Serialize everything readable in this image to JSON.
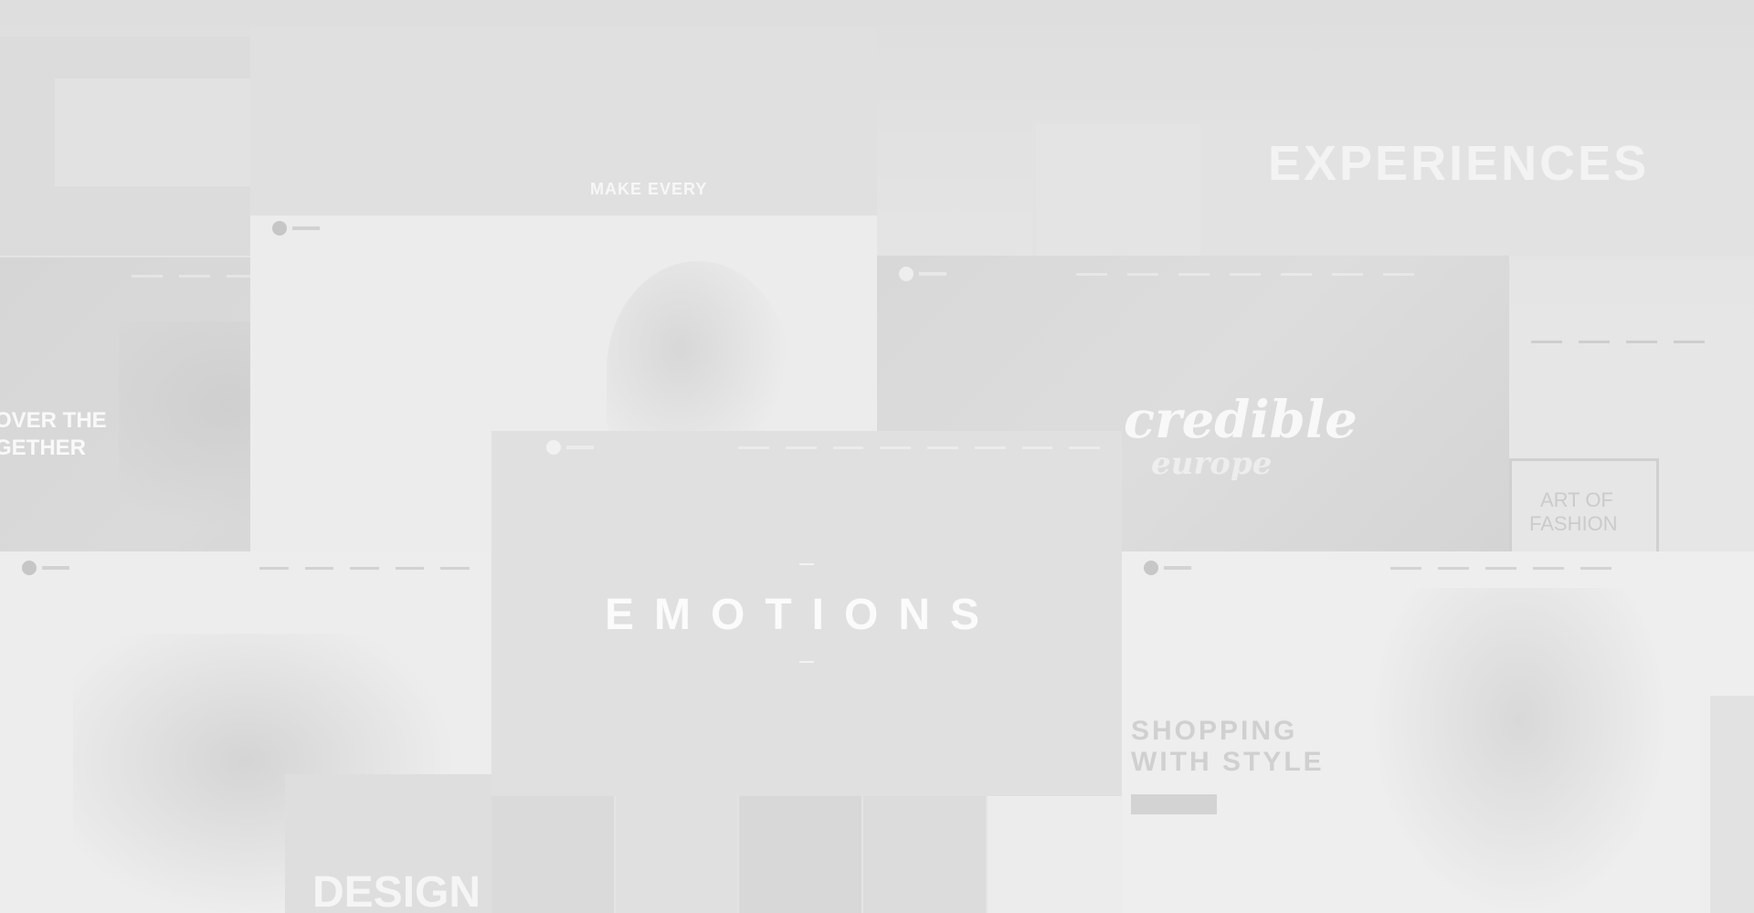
{
  "tiles": {
    "top_center": {
      "headline": "MAKE EVERY"
    },
    "top_right": {
      "headline": "EXPERIENCES"
    },
    "left_mid": {
      "headline_line1": "OVER THE",
      "headline_line2": "GETHER"
    },
    "right_mid": {
      "script_title": "credible",
      "script_subtitle": "europe"
    },
    "far_right": {
      "headline_line1": "ART OF",
      "headline_line2": "FASHION"
    },
    "center": {
      "headline": "EMOTIONS"
    },
    "bottom_left": {
      "headline": "DESIGN"
    },
    "bottom_right": {
      "headline_line1": "SHOPPING",
      "headline_line2": "WITH STYLE"
    }
  }
}
